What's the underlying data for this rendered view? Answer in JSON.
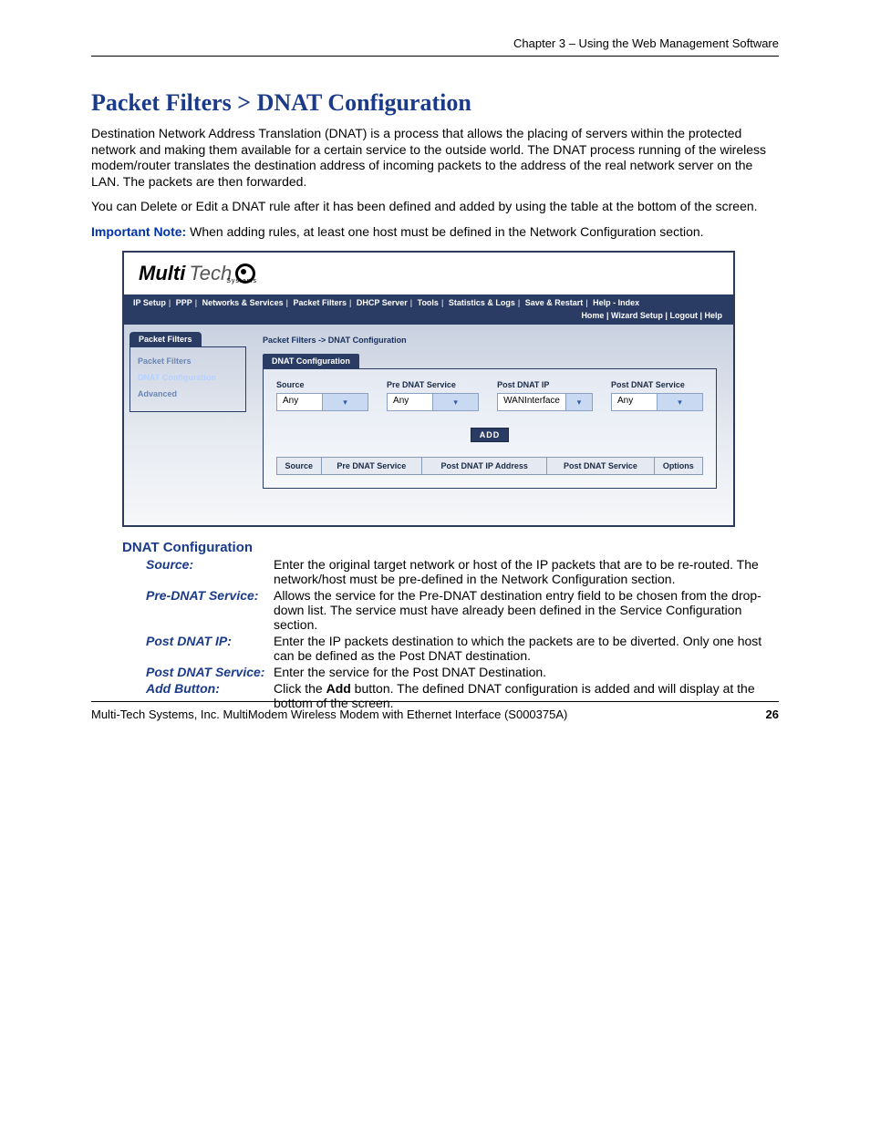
{
  "header": "Chapter 3 – Using the Web Management Software",
  "title": "Packet Filters > DNAT Configuration",
  "intro1": "Destination Network Address Translation (DNAT) is a process that allows the placing of servers within the protected network and making them available for a certain service to the outside world. The DNAT process running of the wireless modem/router translates the destination address of incoming packets to the address of the real network server on the LAN. The packets are then forwarded.",
  "intro2": "You can Delete or Edit a DNAT rule after it has been defined and added by using the table at the bottom of the screen.",
  "important_label": "Important Note:",
  "important_text": " When adding rules, at least one host must be defined in the Network Configuration section.",
  "brand": {
    "multi": "Multi",
    "tech": "Tech",
    "sys": "Systems"
  },
  "nav": [
    "IP Setup",
    "PPP",
    "Networks & Services",
    "Packet Filters",
    "DHCP Server",
    "Tools",
    "Statistics & Logs",
    "Save & Restart",
    "Help - Index"
  ],
  "subnav": [
    "Home",
    "Wizard Setup",
    "Logout",
    "Help"
  ],
  "sidebar": {
    "tab": "Packet Filters",
    "items": [
      "Packet Filters",
      "DNAT Configuration",
      "Advanced"
    ]
  },
  "crumb": "Packet Filters  ->  DNAT Configuration",
  "box_title": "DNAT Configuration",
  "fields": {
    "source": {
      "label": "Source",
      "value": "Any"
    },
    "pre": {
      "label": "Pre DNAT Service",
      "value": "Any"
    },
    "postip": {
      "label": "Post DNAT IP",
      "value": "WANInterface"
    },
    "postsvc": {
      "label": "Post DNAT Service",
      "value": "Any"
    }
  },
  "add_btn": "ADD",
  "table_headers": [
    "Source",
    "Pre DNAT Service",
    "Post DNAT IP Address",
    "Post DNAT Service",
    "Options"
  ],
  "section_heading": "DNAT Configuration",
  "defs": [
    {
      "label": "Source:",
      "text": "Enter the original target network or host of the IP packets that are to be re-routed. The network/host must be pre-defined in the Network Configuration section."
    },
    {
      "label": "Pre-DNAT Service:",
      "text": "Allows the service for the Pre-DNAT destination entry field to be chosen from the drop-down list. The service must have already been defined in the Service Configuration section."
    },
    {
      "label": "Post DNAT IP:",
      "text": "Enter the IP packets destination to which the packets are to be diverted. Only one host can be defined as the Post DNAT destination."
    },
    {
      "label": "Post DNAT Service:",
      "text": "Enter the service for the Post DNAT Destination."
    },
    {
      "label": "Add Button:",
      "text_pre": "Click the ",
      "bold": "Add",
      "text_post": " button. The defined DNAT configuration is added and will display at the bottom of the screen."
    }
  ],
  "footer_text": "Multi-Tech Systems, Inc. MultiModem Wireless Modem with Ethernet Interface (S000375A)",
  "page_number": "26"
}
